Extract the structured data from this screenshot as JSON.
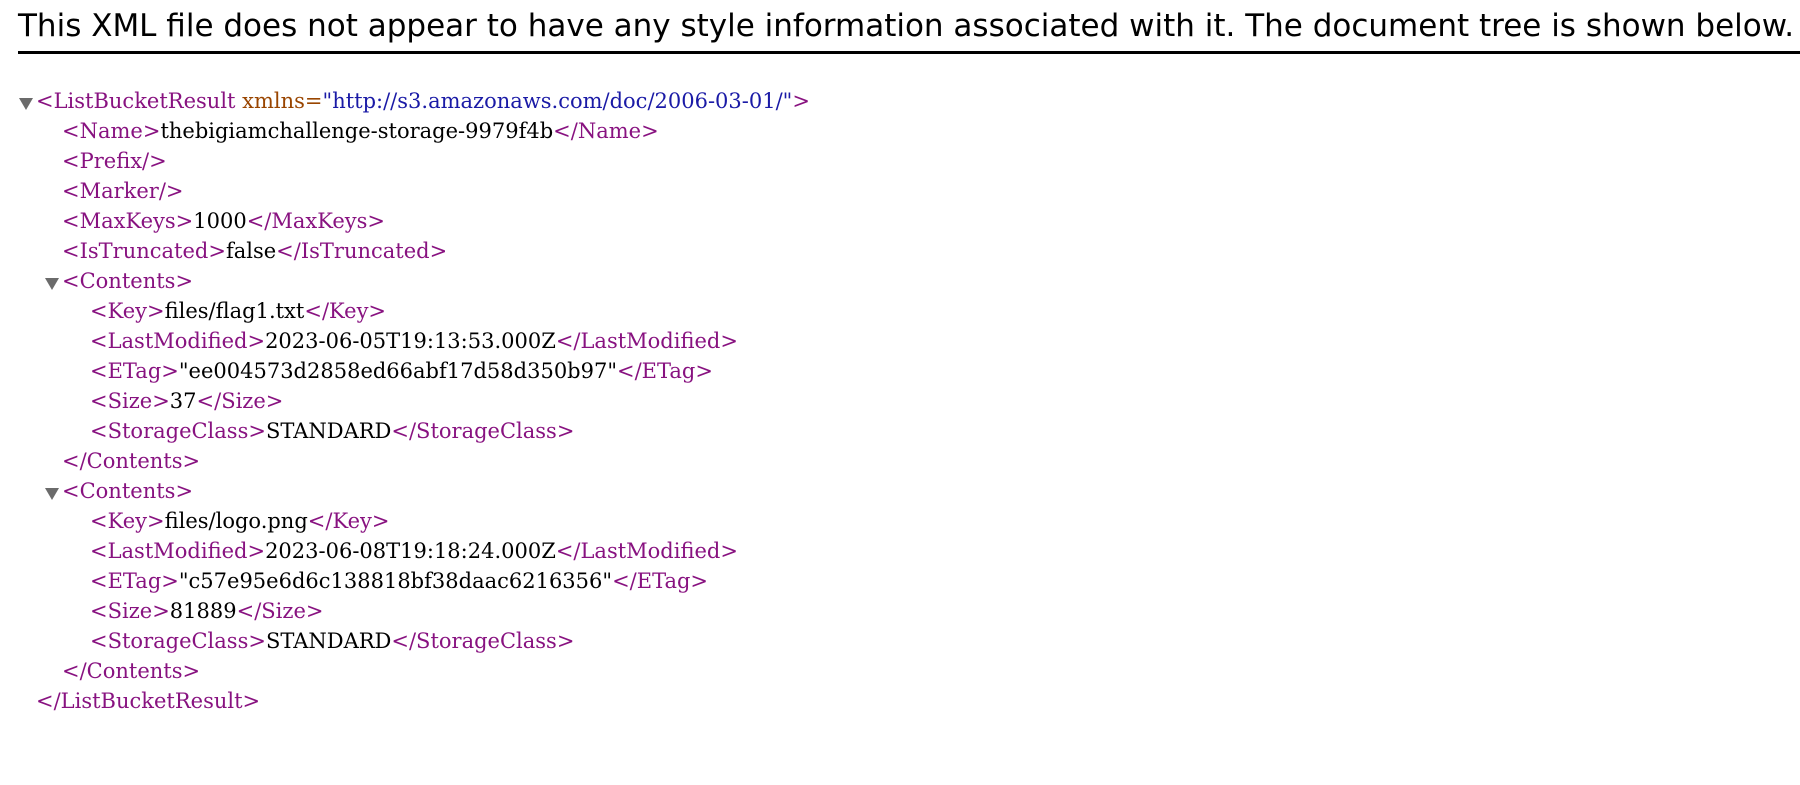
{
  "header": {
    "message": "This XML file does not appear to have any style information associated with it. The document tree is shown below."
  },
  "colors": {
    "tag": "#881280",
    "attribute_name": "#994500",
    "attribute_value": "#1a1aa6",
    "text": "#000000",
    "toggle": "#6b6b6b"
  },
  "icons": {
    "collapse_toggle": "triangle-down-icon"
  },
  "xml": {
    "root_open": "<ListBucketResult",
    "root_attr_name": " xmlns=",
    "root_attr_value": "\"http://s3.amazonaws.com/doc/2006-03-01/\"",
    "root_open_end": ">",
    "name_open": "<Name>",
    "name_value": "thebigiamchallenge-storage-9979f4b",
    "name_close": "</Name>",
    "prefix": "<Prefix/>",
    "marker": "<Marker/>",
    "maxkeys_open": "<MaxKeys>",
    "maxkeys_value": "1000",
    "maxkeys_close": "</MaxKeys>",
    "truncated_open": "<IsTruncated>",
    "truncated_value": "false",
    "truncated_close": "</IsTruncated>",
    "contents": [
      {
        "open": "<Contents>",
        "key_open": "<Key>",
        "key": "files/flag1.txt",
        "key_close": "</Key>",
        "lastmod_open": "<LastModified>",
        "last_modified": "2023-06-05T19:13:53.000Z",
        "lastmod_close": "</LastModified>",
        "etag_open": "<ETag>",
        "etag": "\"ee004573d2858ed66abf17d58d350b97\"",
        "etag_close": "</ETag>",
        "size_open": "<Size>",
        "size": "37",
        "size_close": "</Size>",
        "sc_open": "<StorageClass>",
        "storage_class": "STANDARD",
        "sc_close": "</StorageClass>",
        "close": "</Contents>"
      },
      {
        "open": "<Contents>",
        "key_open": "<Key>",
        "key": "files/logo.png",
        "key_close": "</Key>",
        "lastmod_open": "<LastModified>",
        "last_modified": "2023-06-08T19:18:24.000Z",
        "lastmod_close": "</LastModified>",
        "etag_open": "<ETag>",
        "etag": "\"c57e95e6d6c138818bf38daac6216356\"",
        "etag_close": "</ETag>",
        "size_open": "<Size>",
        "size": "81889",
        "size_close": "</Size>",
        "sc_open": "<StorageClass>",
        "storage_class": "STANDARD",
        "sc_close": "</StorageClass>",
        "close": "</Contents>"
      }
    ],
    "root_close": "</ListBucketResult>"
  }
}
